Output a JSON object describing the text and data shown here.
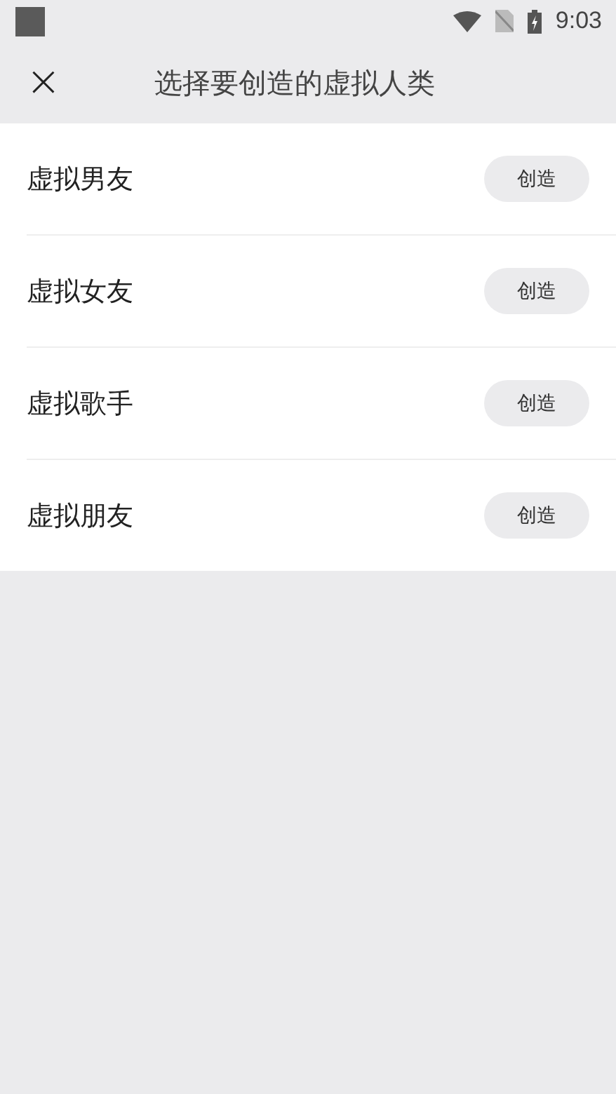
{
  "status_bar": {
    "time": "9:03"
  },
  "header": {
    "close": "×",
    "title": "选择要创造的虚拟人类"
  },
  "items": [
    {
      "label": "虚拟男友",
      "button": "创造"
    },
    {
      "label": "虚拟女友",
      "button": "创造"
    },
    {
      "label": "虚拟歌手",
      "button": "创造"
    },
    {
      "label": "虚拟朋友",
      "button": "创造"
    }
  ]
}
